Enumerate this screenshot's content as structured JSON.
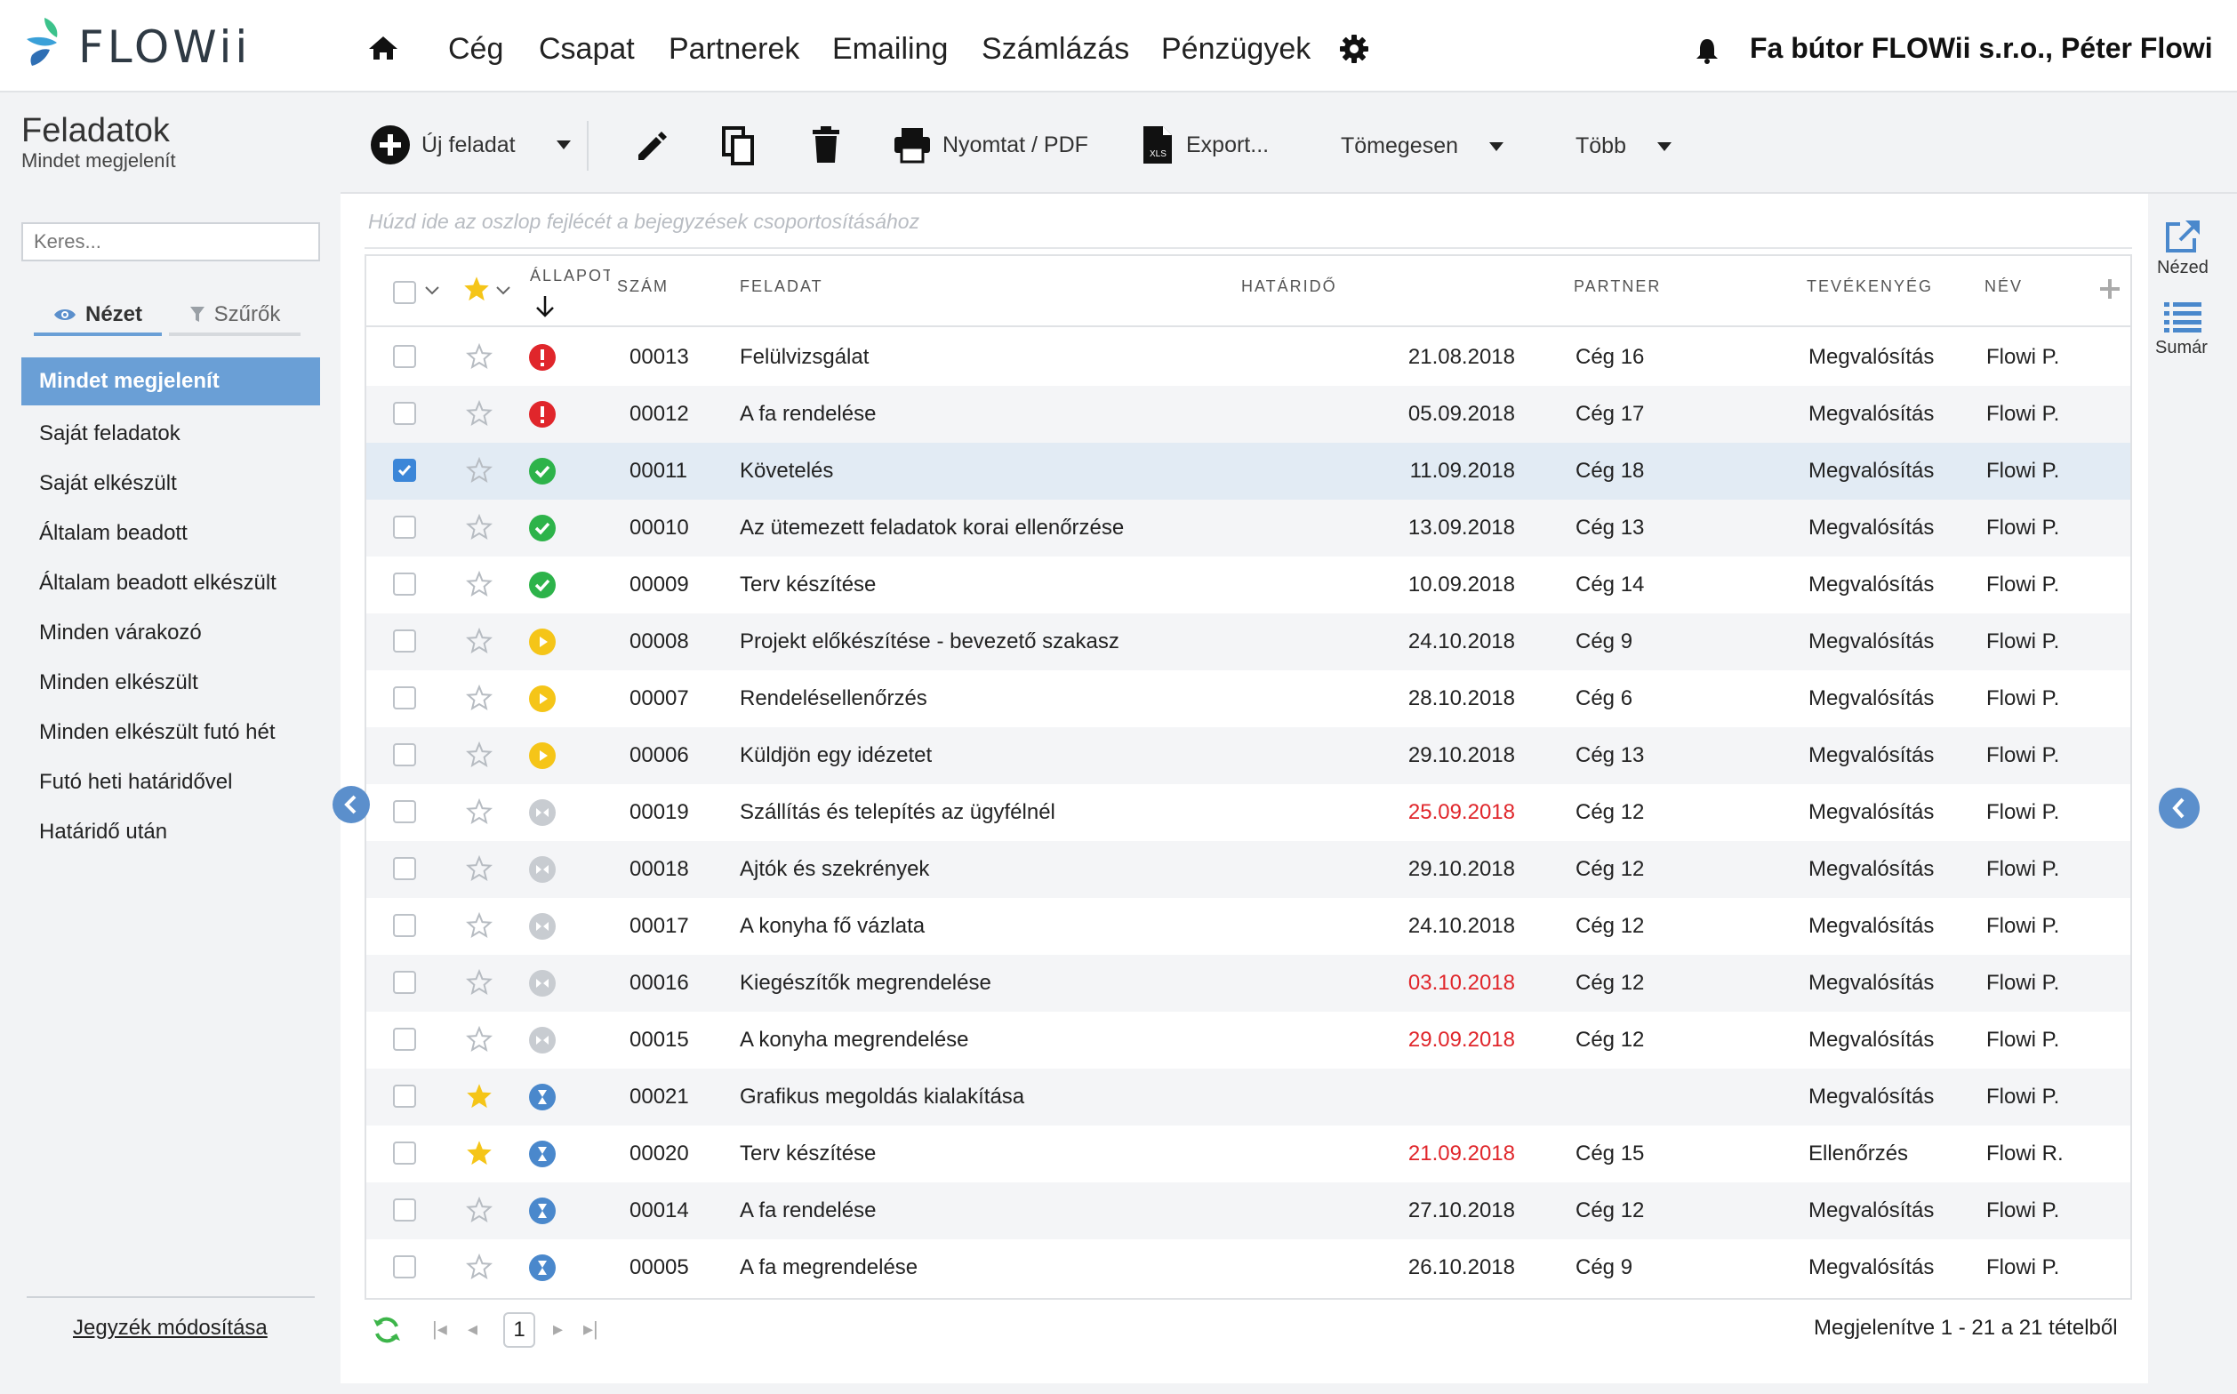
{
  "app": {
    "logo_text": "FLOWii"
  },
  "nav": {
    "items": [
      "Cég",
      "Csapat",
      "Partnerek",
      "Emailing",
      "Számlázás",
      "Pénzügyek"
    ],
    "company": "Fa bútor FLOWii s.r.o., Péter Flowi"
  },
  "page": {
    "title": "Feladatok",
    "subtitle": "Mindet megjelenít"
  },
  "sidebar": {
    "search_placeholder": "Keres...",
    "tab_view": "Nézet",
    "tab_filter": "Szűrők",
    "active_item": "Mindet megjelenít",
    "items": [
      "Saját feladatok",
      "Saját elkészült",
      "Általam beadott",
      "Általam beadott elkészült",
      "Minden várakozó",
      "Minden elkészült",
      "Minden elkészült futó hét",
      "Futó heti határidővel",
      "Határidő után"
    ],
    "modify_link": "Jegyzék módosítása"
  },
  "toolbar": {
    "new_task": "Új feladat",
    "print": "Nyomtat / PDF",
    "export": "Export...",
    "bulk": "Tömegesen",
    "more": "Több"
  },
  "grid": {
    "group_hint": "Húzd ide az oszlop fejlécét a bejegyzések csoportosításához",
    "headers": {
      "status": "ÁLLAPOT",
      "number": "SZÁM",
      "task": "FELADAT",
      "deadline": "HATÁRIDŐ",
      "partner": "PARTNER",
      "activity": "TEVÉKENYÉG",
      "name": "NÉV"
    },
    "rows": [
      {
        "checked": false,
        "starred": false,
        "status": "overdue",
        "number": "00013",
        "task": "Felülvizsgálat",
        "deadline": "21.08.2018",
        "deadline_red": false,
        "partner": "Cég 16",
        "activity": "Megvalósítás",
        "name": "Flowi P."
      },
      {
        "checked": false,
        "starred": false,
        "status": "overdue",
        "number": "00012",
        "task": "A fa rendelése",
        "deadline": "05.09.2018",
        "deadline_red": false,
        "partner": "Cég 17",
        "activity": "Megvalósítás",
        "name": "Flowi P."
      },
      {
        "checked": true,
        "starred": false,
        "status": "done",
        "number": "00011",
        "task": "Követelés",
        "deadline": "11.09.2018",
        "deadline_red": false,
        "partner": "Cég 18",
        "activity": "Megvalósítás",
        "name": "Flowi P."
      },
      {
        "checked": false,
        "starred": false,
        "status": "done",
        "number": "00010",
        "task": "Az ütemezett feladatok korai ellenőrzése",
        "deadline": "13.09.2018",
        "deadline_red": false,
        "partner": "Cég 13",
        "activity": "Megvalósítás",
        "name": "Flowi P."
      },
      {
        "checked": false,
        "starred": false,
        "status": "done",
        "number": "00009",
        "task": "Terv készítése",
        "deadline": "10.09.2018",
        "deadline_red": false,
        "partner": "Cég 14",
        "activity": "Megvalósítás",
        "name": "Flowi P."
      },
      {
        "checked": false,
        "starred": false,
        "status": "running",
        "number": "00008",
        "task": "Projekt előkészítése - bevezető szakasz",
        "deadline": "24.10.2018",
        "deadline_red": false,
        "partner": "Cég 9",
        "activity": "Megvalósítás",
        "name": "Flowi P."
      },
      {
        "checked": false,
        "starred": false,
        "status": "running",
        "number": "00007",
        "task": "Rendelésellenőrzés",
        "deadline": "28.10.2018",
        "deadline_red": false,
        "partner": "Cég 6",
        "activity": "Megvalósítás",
        "name": "Flowi P."
      },
      {
        "checked": false,
        "starred": false,
        "status": "running",
        "number": "00006",
        "task": "Küldjön egy idézetet",
        "deadline": "29.10.2018",
        "deadline_red": false,
        "partner": "Cég 13",
        "activity": "Megvalósítás",
        "name": "Flowi P."
      },
      {
        "checked": false,
        "starred": false,
        "status": "paused",
        "number": "00019",
        "task": "Szállítás és telepítés az ügyfélnél",
        "deadline": "25.09.2018",
        "deadline_red": true,
        "partner": "Cég 12",
        "activity": "Megvalósítás",
        "name": "Flowi P."
      },
      {
        "checked": false,
        "starred": false,
        "status": "paused",
        "number": "00018",
        "task": "Ajtók és szekrények",
        "deadline": "29.10.2018",
        "deadline_red": false,
        "partner": "Cég 12",
        "activity": "Megvalósítás",
        "name": "Flowi P."
      },
      {
        "checked": false,
        "starred": false,
        "status": "paused",
        "number": "00017",
        "task": "A konyha fő vázlata",
        "deadline": "24.10.2018",
        "deadline_red": false,
        "partner": "Cég 12",
        "activity": "Megvalósítás",
        "name": "Flowi P."
      },
      {
        "checked": false,
        "starred": false,
        "status": "paused",
        "number": "00016",
        "task": "Kiegészítők megrendelése",
        "deadline": "03.10.2018",
        "deadline_red": true,
        "partner": "Cég 12",
        "activity": "Megvalósítás",
        "name": "Flowi P."
      },
      {
        "checked": false,
        "starred": false,
        "status": "paused",
        "number": "00015",
        "task": "A konyha megrendelése",
        "deadline": "29.09.2018",
        "deadline_red": true,
        "partner": "Cég 12",
        "activity": "Megvalósítás",
        "name": "Flowi P."
      },
      {
        "checked": false,
        "starred": true,
        "status": "waiting",
        "number": "00021",
        "task": "Grafikus megoldás kialakítása",
        "deadline": "",
        "deadline_red": false,
        "partner": "",
        "activity": "Megvalósítás",
        "name": "Flowi P."
      },
      {
        "checked": false,
        "starred": true,
        "status": "waiting",
        "number": "00020",
        "task": "Terv készítése",
        "deadline": "21.09.2018",
        "deadline_red": true,
        "partner": "Cég 15",
        "activity": "Ellenőrzés",
        "name": "Flowi R."
      },
      {
        "checked": false,
        "starred": false,
        "status": "waiting",
        "number": "00014",
        "task": "A fa rendelése",
        "deadline": "27.10.2018",
        "deadline_red": false,
        "partner": "Cég 12",
        "activity": "Megvalósítás",
        "name": "Flowi P."
      },
      {
        "checked": false,
        "starred": false,
        "status": "waiting",
        "number": "00005",
        "task": "A fa megrendelése",
        "deadline": "26.10.2018",
        "deadline_red": false,
        "partner": "Cég 9",
        "activity": "Megvalósítás",
        "name": "Flowi P."
      }
    ]
  },
  "pager": {
    "current_page": "1",
    "info": "Megjelenítve 1 - 21 a 21 tételből"
  },
  "right_panel": {
    "view_label": "Nézed",
    "summary_label": "Sumár"
  },
  "colors": {
    "accent": "#6a9fd6",
    "overdue": "#e0262b",
    "done": "#2db34a",
    "running": "#f5c518",
    "paused": "#c8ccd1",
    "waiting": "#4a88cc"
  }
}
